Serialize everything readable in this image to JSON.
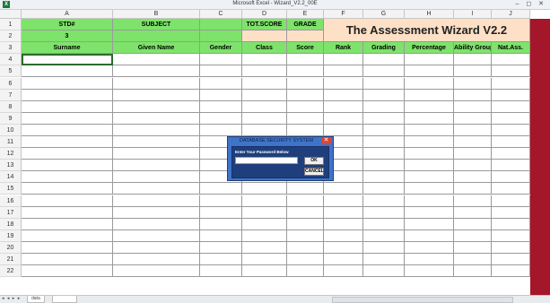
{
  "window": {
    "title": "Microsoft Excel - Wizard_V2.2_00E",
    "app_icon_text": "X",
    "controls": "– ◻ ✕"
  },
  "columns": [
    "",
    "A",
    "B",
    "C",
    "D",
    "E",
    "F",
    "G",
    "H",
    "I",
    "J"
  ],
  "rows": [
    "1",
    "2",
    "3",
    "4",
    "5",
    "6",
    "7",
    "8",
    "9",
    "10",
    "11",
    "12",
    "13",
    "14",
    "15",
    "16",
    "17",
    "18",
    "19",
    "20",
    "21",
    "22"
  ],
  "header_row1": {
    "A": "STD#",
    "B": "SUBJECT",
    "D": "TOT.SCORE",
    "E": "GRADE"
  },
  "header_row2": {
    "A": "3"
  },
  "banner": "The Assessment Wizard V2.2",
  "header_row3": [
    "Surname",
    "Given Name",
    "Gender",
    "Class",
    "Score",
    "Rank",
    "Grading",
    "Percentage",
    "Ability Group",
    "Nat.Ass."
  ],
  "dialog": {
    "title": "DATABASE SECURITY SYSTEM",
    "prompt": "Enter Your Password Below",
    "password_value": "",
    "ok_label": "OK",
    "cancel_label": "CANCEL",
    "close_label": "✕"
  },
  "bottom": {
    "nav": "◂ ◂ ▸ ▸",
    "tab1": "data",
    "tab2": "",
    "colors": {
      "accent_green": "#7ee36a",
      "peach": "#fde0c6",
      "red_bar": "#a4162a",
      "dialog_blue": "#3f74c8"
    }
  }
}
